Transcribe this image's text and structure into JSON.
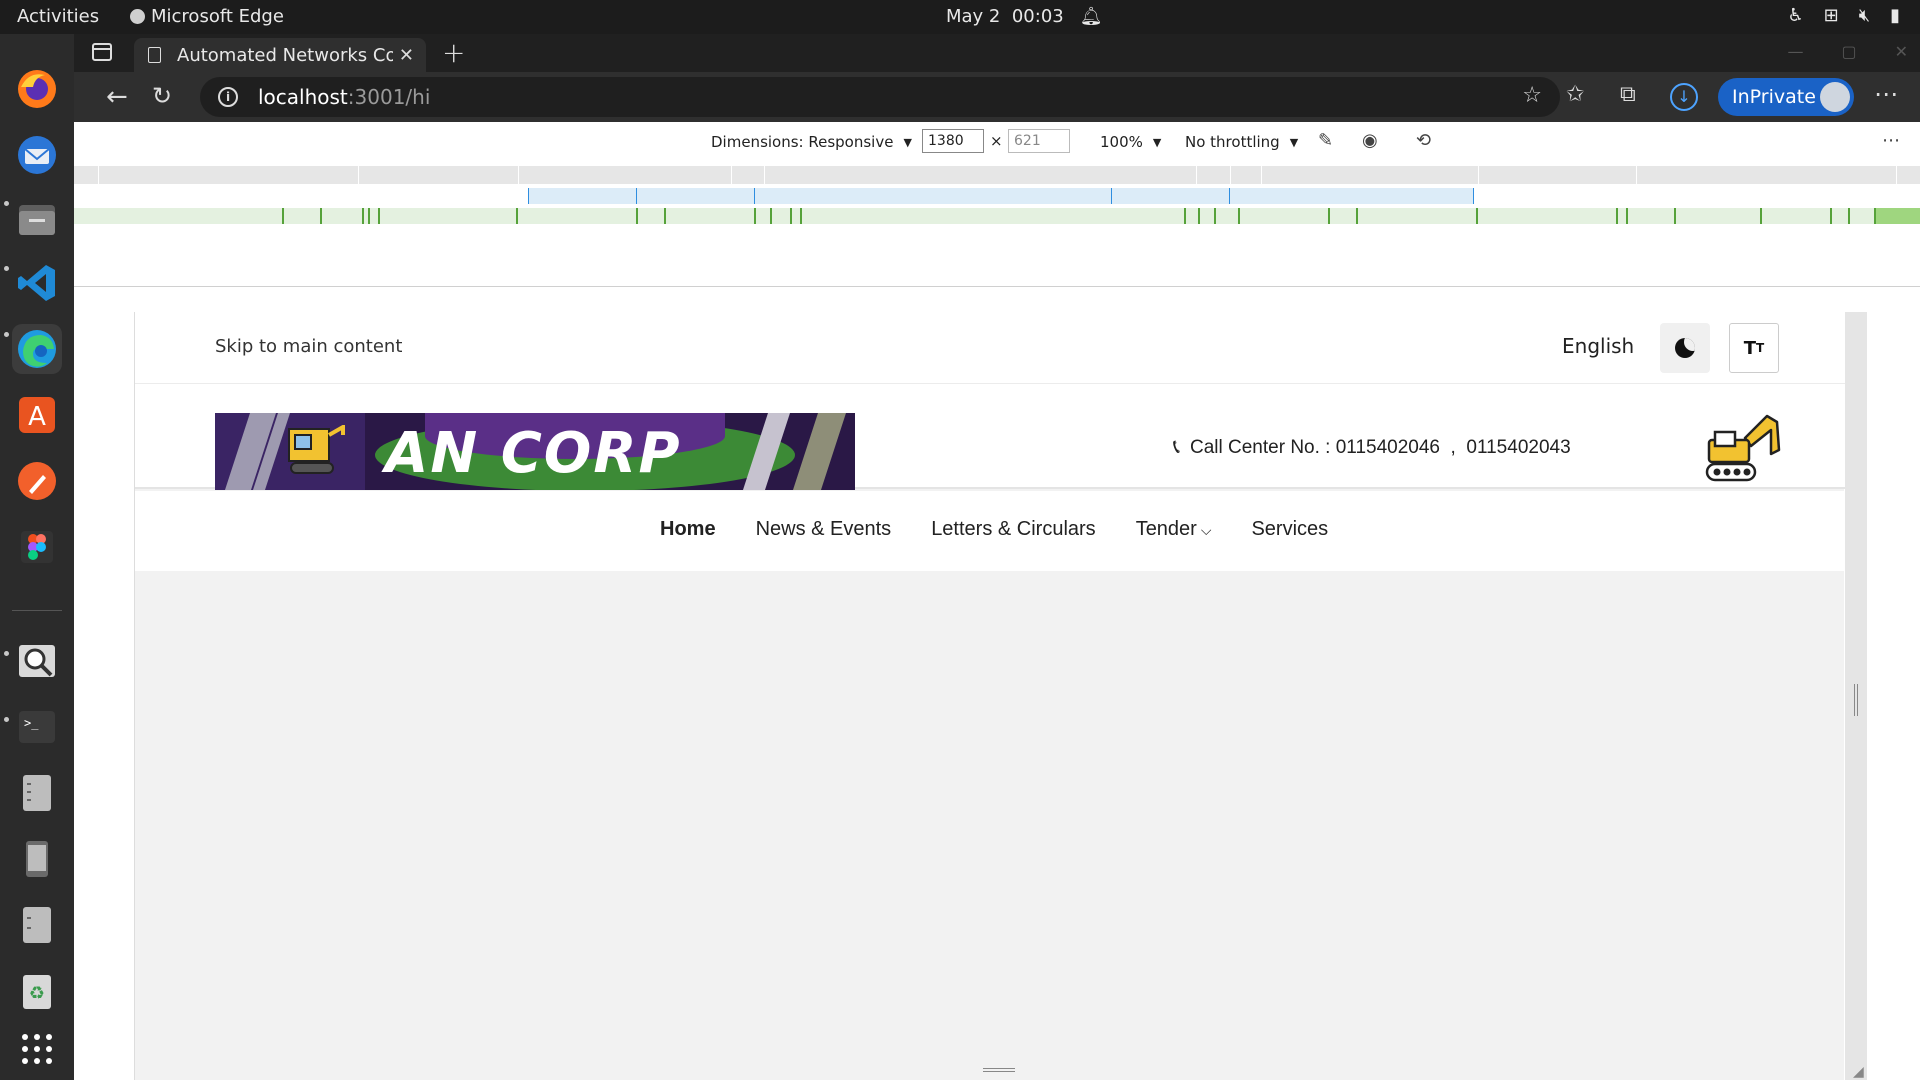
{
  "system": {
    "activities": "Activities",
    "app_name": "Microsoft Edge",
    "date": "May 2",
    "time": "00:03"
  },
  "browser": {
    "tab_title": "Automated Networks Cor",
    "url_host": "localhost",
    "url_rest": ":3001/hi",
    "inprivate_label": "InPrivate"
  },
  "devtools": {
    "dimensions_label": "Dimensions: Responsive",
    "width": "1380",
    "height_placeholder": "621",
    "times": "×",
    "zoom": "100%",
    "throttling": "No throttling"
  },
  "site": {
    "skip_link": "Skip to main content",
    "language": "English",
    "text_size_label": "T",
    "text_size_sup": "T",
    "logo_text": "AN CORP",
    "call_center_label": "Call Center No. : 0115402046",
    "call_center_sep": ",",
    "call_center_number2": "0115402043",
    "nav": {
      "home": "Home",
      "news": "News & Events",
      "letters": "Letters & Circulars",
      "tender": "Tender",
      "services": "Services"
    }
  },
  "colors": {
    "inprivate": "#1a62c6",
    "logo_bg": "#2a1846",
    "logo_green": "#3c8a36",
    "mq_blue": "#2f8ee0",
    "mq_green": "#56a23a"
  }
}
